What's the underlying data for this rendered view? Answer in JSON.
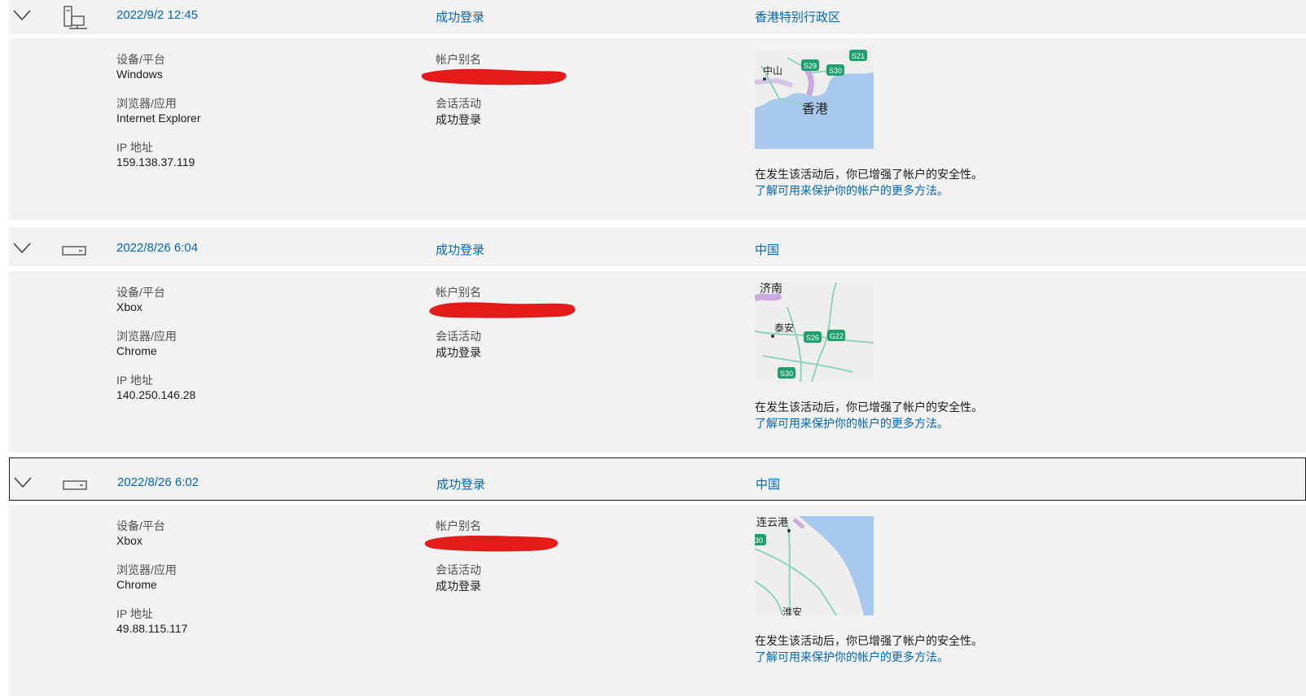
{
  "entries": [
    {
      "datetime": "2022/9/2 12:45",
      "status": "成功登录",
      "location": "香港特别行政区",
      "device_label": "设备/平台",
      "device": "Windows",
      "browser_label": "浏览器/应用",
      "browser": "Internet Explorer",
      "ip_label": "IP 地址",
      "ip": "159.138.37.119",
      "alias_label": "帐户别名",
      "session_label": "会话活动",
      "session": "成功登录",
      "security_note": "在发生该活动后，你已增强了帐户的安全性。",
      "learn_more": "了解可用来保护你的帐户的更多方法。",
      "map": {
        "labels": [
          "中山",
          "香港"
        ],
        "shields": [
          "S29",
          "S30",
          "S21"
        ]
      }
    },
    {
      "datetime": "2022/8/26 6:04",
      "status": "成功登录",
      "location": "中国",
      "device_label": "设备/平台",
      "device": "Xbox",
      "browser_label": "浏览器/应用",
      "browser": "Chrome",
      "ip_label": "IP 地址",
      "ip": "140.250.146.28",
      "alias_label": "帐户别名",
      "session_label": "会话活动",
      "session": "成功登录",
      "security_note": "在发生该活动后，你已增强了帐户的安全性。",
      "learn_more": "了解可用来保护你的帐户的更多方法。",
      "map": {
        "labels": [
          "济南",
          "泰安"
        ],
        "shields": [
          "S26",
          "G22",
          "S30"
        ]
      }
    },
    {
      "datetime": "2022/8/26 6:02",
      "status": "成功登录",
      "location": "中国",
      "device_label": "设备/平台",
      "device": "Xbox",
      "browser_label": "浏览器/应用",
      "browser": "Chrome",
      "ip_label": "IP 地址",
      "ip": "49.88.115.117",
      "alias_label": "帐户别名",
      "session_label": "会话活动",
      "session": "成功登录",
      "security_note": "在发生该活动后，你已增强了帐户的安全性。",
      "learn_more": "了解可用来保护你的帐户的更多方法。",
      "map": {
        "labels": [
          "连云港",
          "淮安"
        ],
        "shields": [
          "30"
        ]
      }
    }
  ],
  "colors": {
    "link": "#0067b8",
    "panel": "#f2f2f2",
    "redaction": "#e31b1b",
    "map_water": "#a8c8ee",
    "map_land": "#eeeeec",
    "map_road": "#8fd3bd"
  },
  "icons": {
    "expand": "chevron-down-icon",
    "desktop": "desktop-computer-icon",
    "console": "game-console-icon"
  }
}
